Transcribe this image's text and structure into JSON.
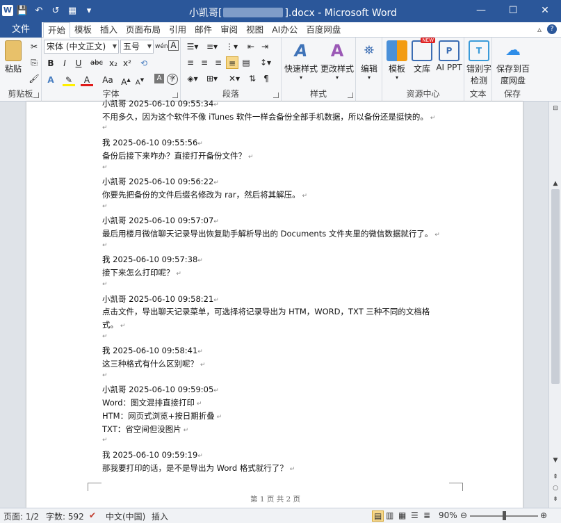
{
  "window": {
    "title_prefix": "小凯哥[",
    "title_suffix": "].docx - Microsoft Word",
    "minimize": "—",
    "maximize": "☐",
    "close": "✕",
    "app_icon": "W"
  },
  "qat": [
    "💾",
    "↶",
    "↺",
    "▦",
    "▾"
  ],
  "tabs": {
    "file": "文件",
    "items": [
      "开始",
      "模板",
      "插入",
      "页面布局",
      "引用",
      "邮件",
      "审阅",
      "视图",
      "AI办公",
      "百度网盘"
    ],
    "right_icons": [
      "▵",
      "?"
    ]
  },
  "ribbon": {
    "clipboard": {
      "label": "剪贴板",
      "paste": "粘贴"
    },
    "font": {
      "label": "字体",
      "name": "宋体 (中文正文)",
      "size": "五号",
      "wen": "wén"
    },
    "paragraph": {
      "label": "段落"
    },
    "styles": {
      "label": "样式",
      "quick": "快速样式",
      "change": "更改样式"
    },
    "edit": {
      "label": "编辑"
    },
    "template": {
      "label": "模板"
    },
    "library": {
      "label": "文库",
      "badge": "NEW"
    },
    "ai_ppt": {
      "label": "AI PPT"
    },
    "resource_group": "资源中心",
    "spell": {
      "label": "错别字检测",
      "line1": "错别字",
      "line2": "检测"
    },
    "text_group": "文本",
    "save_baidu": {
      "line1": "保存到百",
      "line2": "度网盘"
    },
    "save_group": "保存"
  },
  "document": {
    "messages": [
      {
        "header": "小凯哥  2025-06-10 09:55:34",
        "lines": [
          "不用多久，因为这个软件不像 iTunes 软件一样会备份全部手机数据，所以备份还是挺快的。"
        ]
      },
      {
        "header": "我  2025-06-10 09:55:56",
        "lines": [
          "备份后接下来咋办？直接打开备份文件？"
        ]
      },
      {
        "header": "小凯哥  2025-06-10 09:56:22",
        "lines": [
          "你要先把备份的文件后缀名修改为 rar，然后将其解压。"
        ]
      },
      {
        "header": "小凯哥  2025-06-10 09:57:07",
        "lines": [
          "最后用楼月微信聊天记录导出恢复助手解析导出的 Documents 文件夹里的微信数据就行了。"
        ]
      },
      {
        "header": "我  2025-06-10 09:57:38",
        "lines": [
          "接下来怎么打印呢？"
        ]
      },
      {
        "header": "小凯哥  2025-06-10 09:58:21",
        "lines": [
          "点击文件，导出聊天记录菜单，可选择将记录导出为 HTM，WORD，TXT 三种不同的文档格",
          "式。"
        ]
      },
      {
        "header": "我  2025-06-10 09:58:41",
        "lines": [
          "这三种格式有什么区别呢？"
        ]
      },
      {
        "header": "小凯哥  2025-06-10 09:59:05",
        "lines": [
          "Word：图文混排直接打印",
          "HTM：网页式浏览+按日期折叠",
          "TXT：省空间但没图片"
        ]
      },
      {
        "header": "我  2025-06-10 09:59:19",
        "lines": [
          "那我要打印的话，是不是导出为 Word 格式就行了？"
        ]
      }
    ],
    "footer": "第 1 页  共 2 页"
  },
  "status": {
    "page": "页面: 1/2",
    "words": "字数: 592",
    "lang": "中文(中国)",
    "mode": "插入",
    "zoom": "90%",
    "zoom_level": 0.5
  }
}
